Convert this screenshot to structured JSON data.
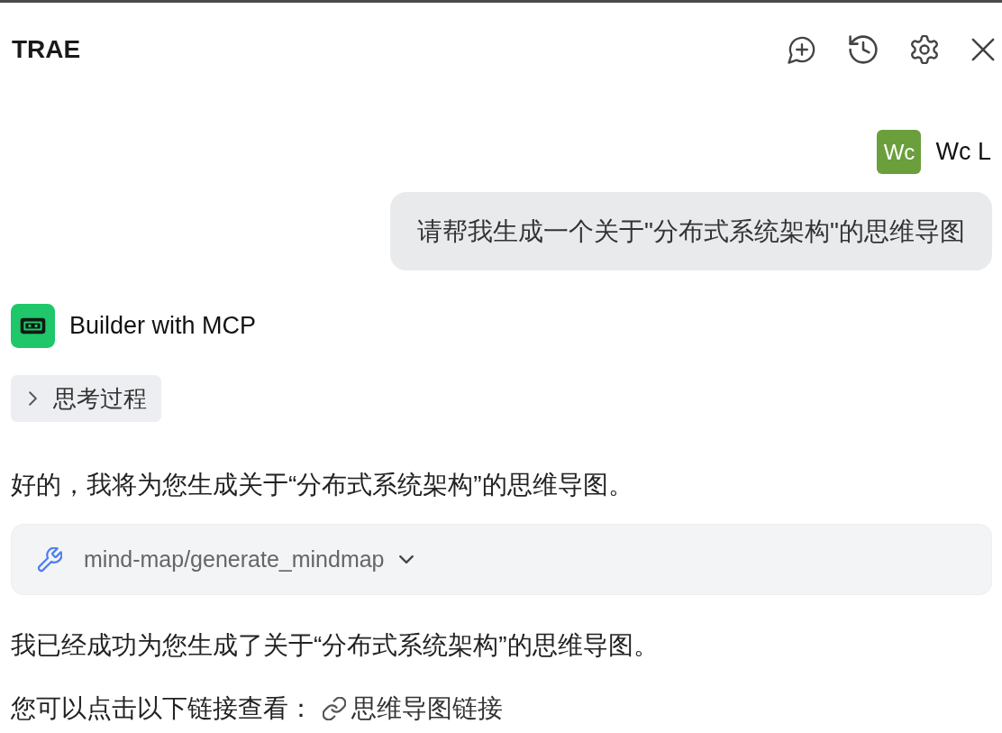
{
  "header": {
    "title": "TRAE"
  },
  "user_message": {
    "avatar": "Wc",
    "name": "Wc L",
    "text": "请帮我生成一个关于\"分布式系统架构\"的思维导图"
  },
  "assistant": {
    "name": "Builder with MCP",
    "thinking": {
      "label": "思考过程",
      "expanded": false
    },
    "blocks": [
      {
        "kind": "paragraph",
        "text": "好的，我将为您生成关于“分布式系统架构”的思维导图。"
      },
      {
        "kind": "tool",
        "name": "mind-map/generate_mindmap",
        "expanded": false
      },
      {
        "kind": "paragraph",
        "text": "我已经成功为您生成了关于“分布式系统架构”的思维导图。"
      },
      {
        "kind": "link_line",
        "text": "您可以点击以下链接查看：",
        "link": "思维导图链接"
      }
    ]
  }
}
